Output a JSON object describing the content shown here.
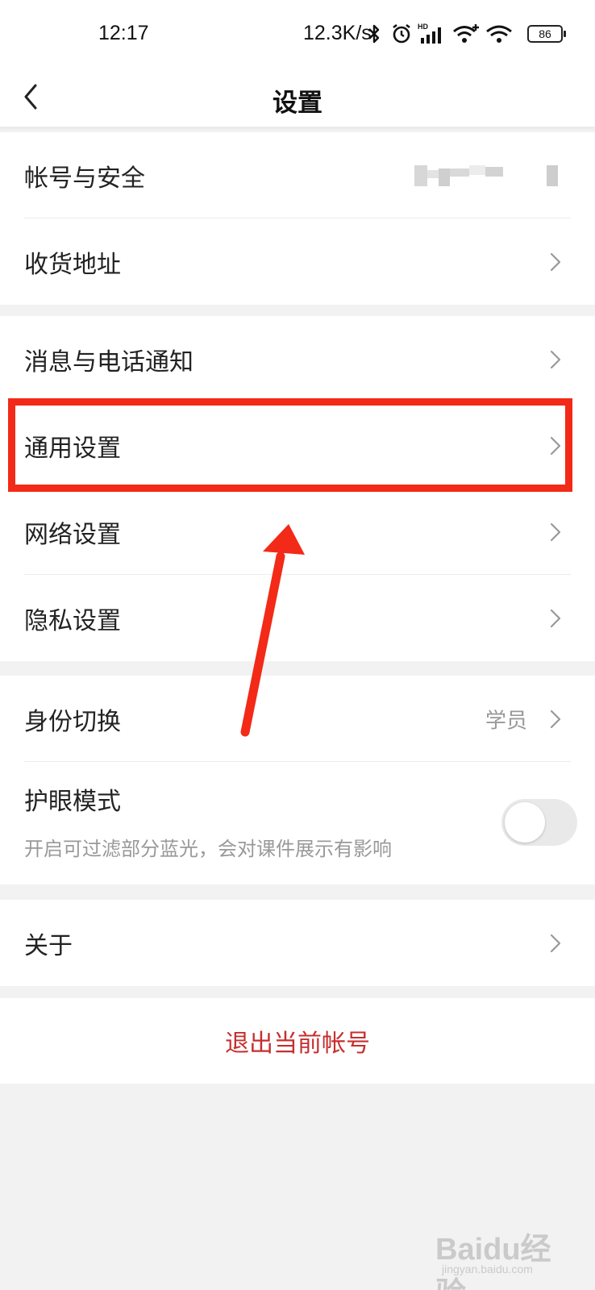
{
  "status_bar": {
    "time": "12:17",
    "net_speed": "12.3K/s",
    "battery": "86",
    "icons": [
      "bluetooth-icon",
      "alarm-icon",
      "hd-signal-icon",
      "wifi-plus-icon",
      "wifi-icon",
      "battery-icon"
    ]
  },
  "header": {
    "title": "设置",
    "back_icon": "back-arrow-icon"
  },
  "groups": {
    "account": {
      "security_label": "帐号与安全",
      "address_label": "收货地址"
    },
    "settings": {
      "notify_label": "消息与电话通知",
      "general_label": "通用设置",
      "network_label": "网络设置",
      "privacy_label": "隐私设置"
    },
    "identity": {
      "switch_label": "身份切换",
      "switch_value": "学员",
      "eye_label": "护眼模式",
      "eye_sub": "开启可过滤部分蓝光，会对课件展示有影响",
      "eye_enabled": false
    },
    "about": {
      "about_label": "关于"
    }
  },
  "logout": {
    "label": "退出当前帐号"
  },
  "annotation": {
    "highlight_color": "#f22a17"
  },
  "watermark": {
    "text": "Baidu经验",
    "sub": "jingyan.baidu.com"
  },
  "colors": {
    "logout_red": "#c62f2f",
    "background": "#f2f2f2",
    "secondary_text": "#999999"
  }
}
